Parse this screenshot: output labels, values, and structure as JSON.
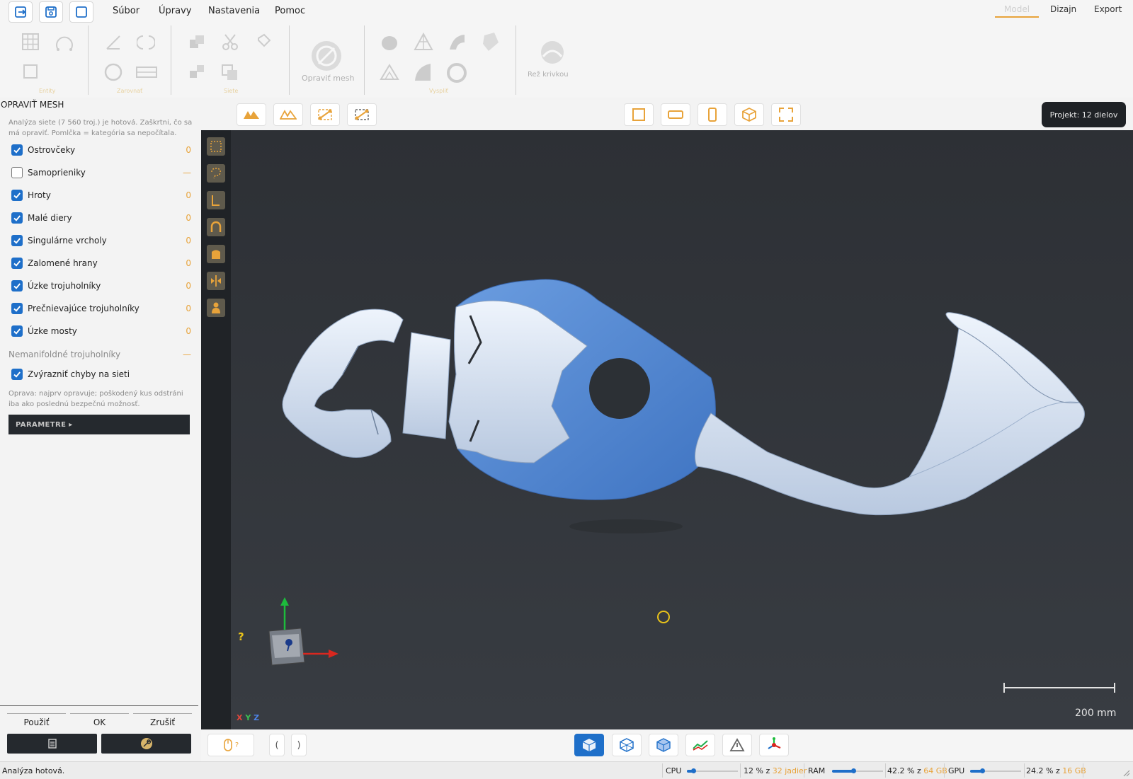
{
  "menu": {
    "items": [
      "Súbor",
      "Úpravy",
      "Nastavenia",
      "Pomoc"
    ],
    "tabs": [
      "Model",
      "Dizajn",
      "Export"
    ]
  },
  "ribbon": {
    "groups": [
      "Entity",
      "Zarovnať",
      "Siete",
      "Vyspliť"
    ],
    "repair_mesh_label": "Opraviť mesh",
    "cut_curve_label": "Rež krivkou"
  },
  "project_badge": "Projekt: 12 dielov",
  "panel": {
    "title": "OPRAVIŤ MESH",
    "description": "Analýza siete (7 560 troj.) je hotová. Zaškrtni, čo sa má opraviť. Pomlčka = kategória sa nepočítala.",
    "checks": [
      {
        "label": "Ostrovčeky",
        "checked": true,
        "count": "0"
      },
      {
        "label": "Samoprieniky",
        "checked": false,
        "count": "—"
      },
      {
        "label": "Hroty",
        "checked": true,
        "count": "0"
      },
      {
        "label": "Malé diery",
        "checked": true,
        "count": "0"
      },
      {
        "label": "Singulárne vrcholy",
        "checked": true,
        "count": "0"
      },
      {
        "label": "Zalomené hrany",
        "checked": true,
        "count": "0"
      },
      {
        "label": "Úzke trojuholníky",
        "checked": true,
        "count": "0"
      },
      {
        "label": "Prečnievajúce trojuholníky",
        "checked": true,
        "count": "0"
      },
      {
        "label": "Úzke mosty",
        "checked": true,
        "count": "0"
      }
    ],
    "nonmanifold_label": "Nemanifoldné trojuholníky",
    "nonmanifold_count": "—",
    "highlight_label": "Zvýrazniť chyby na sieti",
    "highlight_checked": true,
    "repair_note": "Oprava: najprv opravuje; poškodený kus odstráni iba ako poslednú bezpečnú možnosť.",
    "params_label": "PARAMETRE ▸",
    "buttons": {
      "apply": "Použiť",
      "ok": "OK",
      "cancel": "Zrušiť"
    }
  },
  "viewport": {
    "axis_x": "X",
    "axis_y": "Y",
    "axis_z": "Z",
    "scale_label": "200 mm",
    "help_mark": "?",
    "colors": {
      "part": "#dfe9f7",
      "selected": "#4f86d1",
      "background": "#33363b"
    }
  },
  "bottombar": {
    "mouse_hint": "?",
    "bracket_left": "(",
    "bracket_right": ")"
  },
  "status": {
    "text": "Analýza hotová.",
    "cpu": {
      "label": "CPU",
      "value": "12 % z",
      "extra": "32 jadier",
      "fraction": 0.12
    },
    "ram": {
      "label": "RAM",
      "value": "42.2 % z",
      "extra": "64 GB",
      "fraction": 0.422
    },
    "gpu": {
      "label": "GPU",
      "value": "24.2 % z",
      "extra": "16 GB",
      "fraction": 0.242
    }
  }
}
